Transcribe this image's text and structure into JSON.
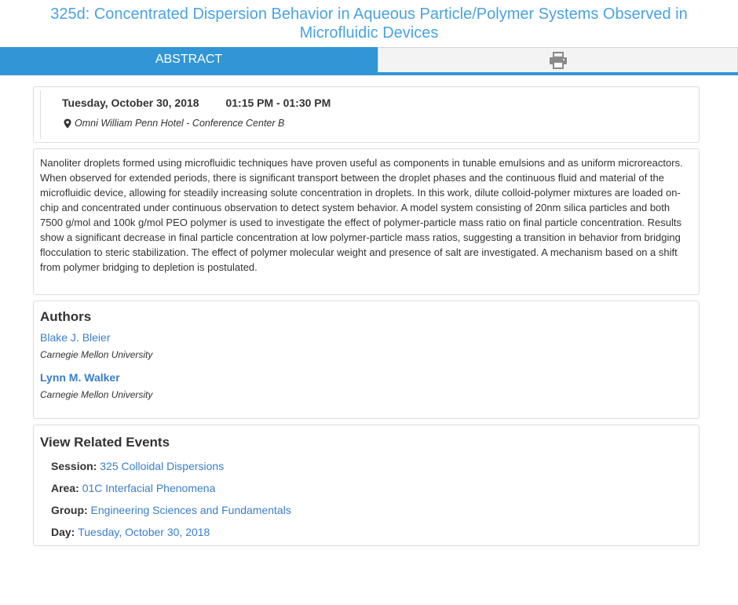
{
  "page": {
    "title": "325d: Concentrated Dispersion Behavior in Aqueous Particle/Polymer Systems Observed in Microfluidic Devices"
  },
  "tabs": {
    "abstract_label": "ABSTRACT",
    "print_icon": "printer-icon"
  },
  "event": {
    "date": "Tuesday, October 30, 2018",
    "time": "01:15 PM - 01:30 PM",
    "location": "Omni William Penn Hotel - Conference Center B",
    "location_icon": "map-marker-icon"
  },
  "abstract": {
    "text": "Nanoliter droplets formed using microfluidic techniques have proven useful as components in tunable emulsions and as uniform microreactors. When observed for extended periods, there is significant transport between the droplet phases and the continuous fluid and material of the microfluidic device, allowing for steadily increasing solute concentration in droplets. In this work, dilute colloid-polymer mixtures are loaded on-chip and concentrated under continuous observation to detect system behavior. A model system consisting of 20nm silica particles and both 7500 g/mol and 100k g/mol PEO polymer is used to investigate the effect of polymer-particle mass ratio on final particle concentration. Results show a significant decrease in final particle concentration at low polymer-particle mass ratios, suggesting a transition in behavior from bridging flocculation to steric stabilization. The effect of polymer molecular weight and presence of salt are investigated. A mechanism based on a shift from polymer bridging to depletion is postulated."
  },
  "authors": {
    "heading": "Authors",
    "list": [
      {
        "name": "Blake J. Bleier",
        "affiliation": "Carnegie Mellon University"
      },
      {
        "name": "Lynn M. Walker",
        "affiliation": "Carnegie Mellon University"
      }
    ]
  },
  "related": {
    "heading": "View Related Events",
    "items": [
      {
        "label": "Session:",
        "value": "325 Colloidal Dispersions"
      },
      {
        "label": "Area:",
        "value": "01C Interfacial Phenomena"
      },
      {
        "label": "Group:",
        "value": "Engineering Sciences and Fundamentals"
      },
      {
        "label": "Day:",
        "value": "Tuesday, October 30, 2018"
      }
    ]
  },
  "colors": {
    "title": "#4aa3df",
    "tab_active": "#3296d6",
    "link": "#3a7ec8"
  }
}
